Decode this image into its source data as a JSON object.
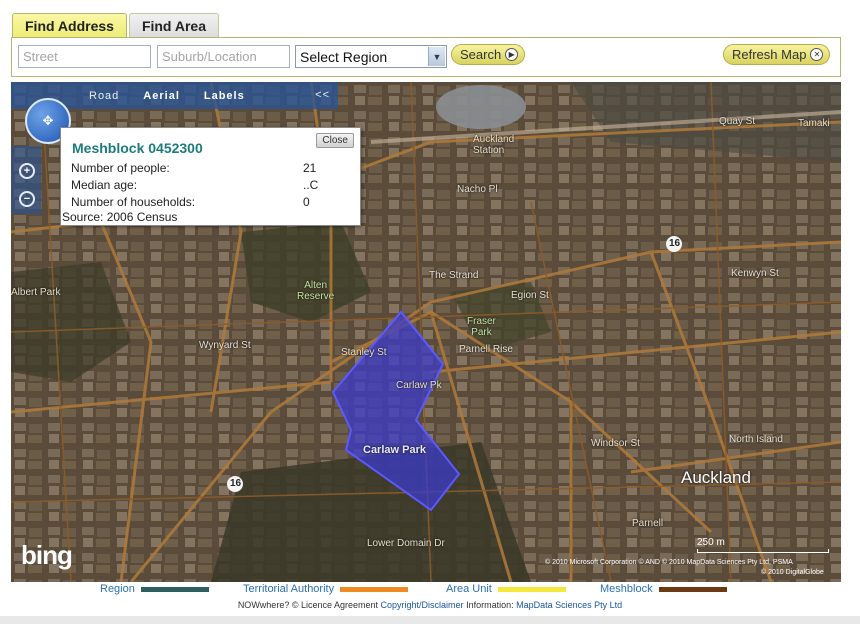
{
  "tabs": [
    {
      "label": "Find Address",
      "active": true
    },
    {
      "label": "Find Area",
      "active": false
    }
  ],
  "search": {
    "street_placeholder": "Street",
    "suburb_placeholder": "Suburb/Location",
    "region_selected": "Select Region",
    "search_label": "Search",
    "refresh_label": "Refresh Map"
  },
  "map_toolbar": {
    "road": "Road",
    "aerial": "Aerial",
    "labels": "Labels",
    "collapse": "<<"
  },
  "popup": {
    "title": "Meshblock 0452300",
    "close": "Close",
    "rows": [
      {
        "key": "Number of people:",
        "value": "21"
      },
      {
        "key": "Median age:",
        "value": "..C"
      },
      {
        "key": "Number of households:",
        "value": "0"
      }
    ],
    "source": "Source: 2006 Census"
  },
  "map_labels": {
    "auckland_station": "Auckland\nStation",
    "quay_st": "Quay St",
    "tamaki": "Tamaki",
    "nacho_pl": "Nacho Pl",
    "the_strand": "The Strand",
    "albert_park": "Albert Park",
    "alten_reserve": "Alten\nReserve",
    "fraser_park": "Fraser\nPark",
    "parnell_rise": "Parnell Rise",
    "carlaw_park": "Carlaw Park",
    "north_island": "North Island",
    "auckland": "Auckland",
    "parnell": "Parnell",
    "stanley_st": "Stanley St",
    "carlaw_pk": "Carlaw Pk",
    "route_16": "16",
    "route_16b": "16",
    "windsor_st": "Windsor St",
    "lower_domain": "Lower Domain Dr",
    "kenwyn_st": "Kenwyn St",
    "egion_st": "Egion St",
    "wynyard_st": "Wynyard St"
  },
  "attribution": {
    "bing": "bing",
    "copyright1": "© 2010 Microsoft Corporation   © AND   © 2010 MapData Sciences Pty Ltd, PSMA",
    "copyright2": "© 2010 DigitalGlobe",
    "scale": "250 m"
  },
  "legend": [
    {
      "label": "Region",
      "color": "#2f5f5f"
    },
    {
      "label": "Territorial Authority",
      "color": "#ef8a21"
    },
    {
      "label": "Area Unit",
      "color": "#f5e83a"
    },
    {
      "label": "Meshblock",
      "color": "#6b3a12"
    }
  ],
  "footer": {
    "prefix": "NOWwhere? © Licence Agreement",
    "link1": "Copyright/Disclaimer",
    "middle": "Information:",
    "link2": "MapData Sciences Pty Ltd"
  },
  "colors": {
    "highlight": "#3a3ad0",
    "tab_active": "#f2ee86",
    "accent_text": "#1c7c7c"
  }
}
